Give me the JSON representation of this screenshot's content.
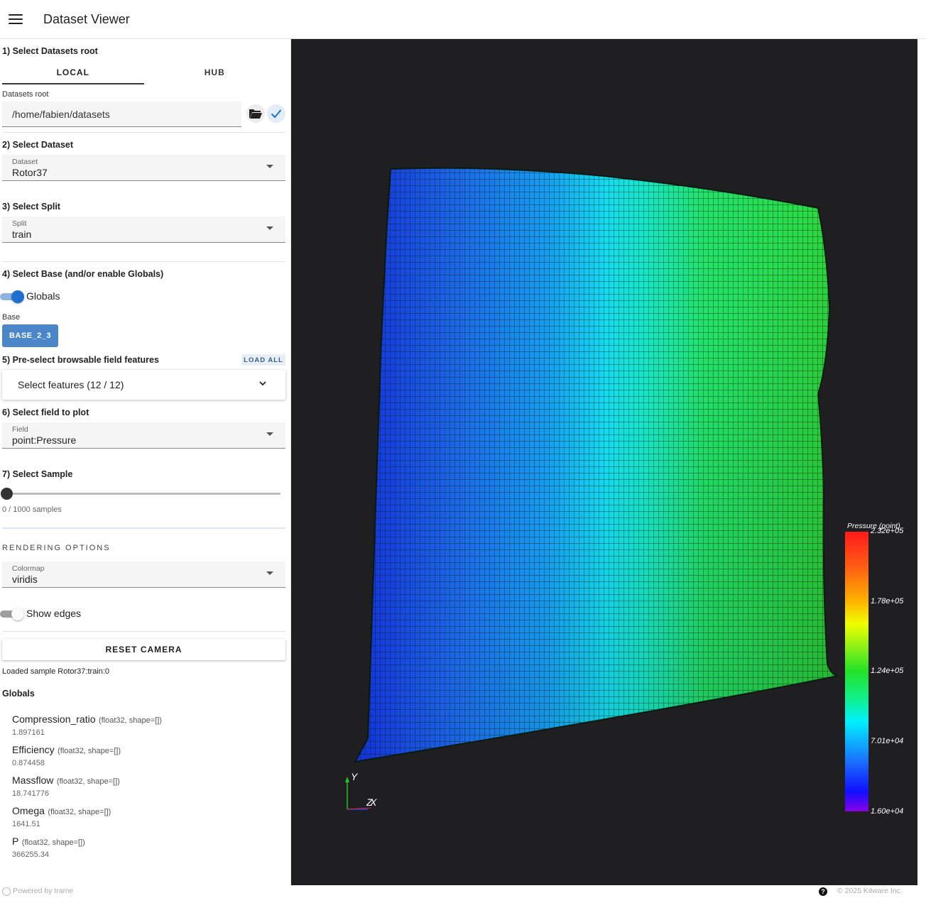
{
  "app": {
    "title": "Dataset Viewer"
  },
  "step1": {
    "title": "1) Select Datasets root",
    "tabs": [
      "LOCAL",
      "HUB"
    ],
    "root_label": "Datasets root",
    "root_value": "/home/fabien/datasets"
  },
  "step2": {
    "title": "2) Select Dataset",
    "label": "Dataset",
    "value": "Rotor37"
  },
  "step3": {
    "title": "3) Select Split",
    "label": "Split",
    "value": "train"
  },
  "step4": {
    "title": "4) Select Base (and/or enable Globals)",
    "globals_label": "Globals",
    "base_label": "Base",
    "base_chip": "BASE_2_3"
  },
  "step5": {
    "title": "5) Pre-select browsable field features",
    "load_all": "LOAD ALL",
    "select_text": "Select features (12 / 12)"
  },
  "step6": {
    "title": "6) Select field to plot",
    "label": "Field",
    "value": "point:Pressure"
  },
  "step7": {
    "title": "7) Select Sample",
    "sample_text": "0 / 1000 samples",
    "sample_fraction": 0
  },
  "rendering": {
    "title": "RENDERING OPTIONS",
    "colormap_label": "Colormap",
    "colormap_value": "viridis",
    "show_edges_label": "Show edges",
    "reset_camera": "RESET CAMERA",
    "status": "Loaded sample Rotor37:train:0"
  },
  "globals": {
    "title": "Globals",
    "items": [
      {
        "name": "Compression_ratio",
        "meta": "(float32, shape=[])",
        "value": "1.897161"
      },
      {
        "name": "Efficiency",
        "meta": "(float32, shape=[])",
        "value": "0.874458"
      },
      {
        "name": "Massflow",
        "meta": "(float32, shape=[])",
        "value": "18.741776"
      },
      {
        "name": "Omega",
        "meta": "(float32, shape=[])",
        "value": "1641.51"
      },
      {
        "name": "P",
        "meta": "(float32, shape=[])",
        "value": "366255.34"
      }
    ]
  },
  "scalar_bar": {
    "title": "Pressure (point)",
    "labels": [
      "2.32e+05",
      "1.78e+05",
      "1.24e+05",
      "7.01e+04",
      "1.60e+04"
    ]
  },
  "axes": {
    "y": "Y",
    "z": "Z",
    "x": "X"
  },
  "footer": {
    "left": "Powered by trame",
    "right": "© 2025 Kitware Inc."
  },
  "colors": {
    "accent": "#1e6fd0",
    "chip": "#4a86c8",
    "viewport_bg": "#1f1f22"
  }
}
